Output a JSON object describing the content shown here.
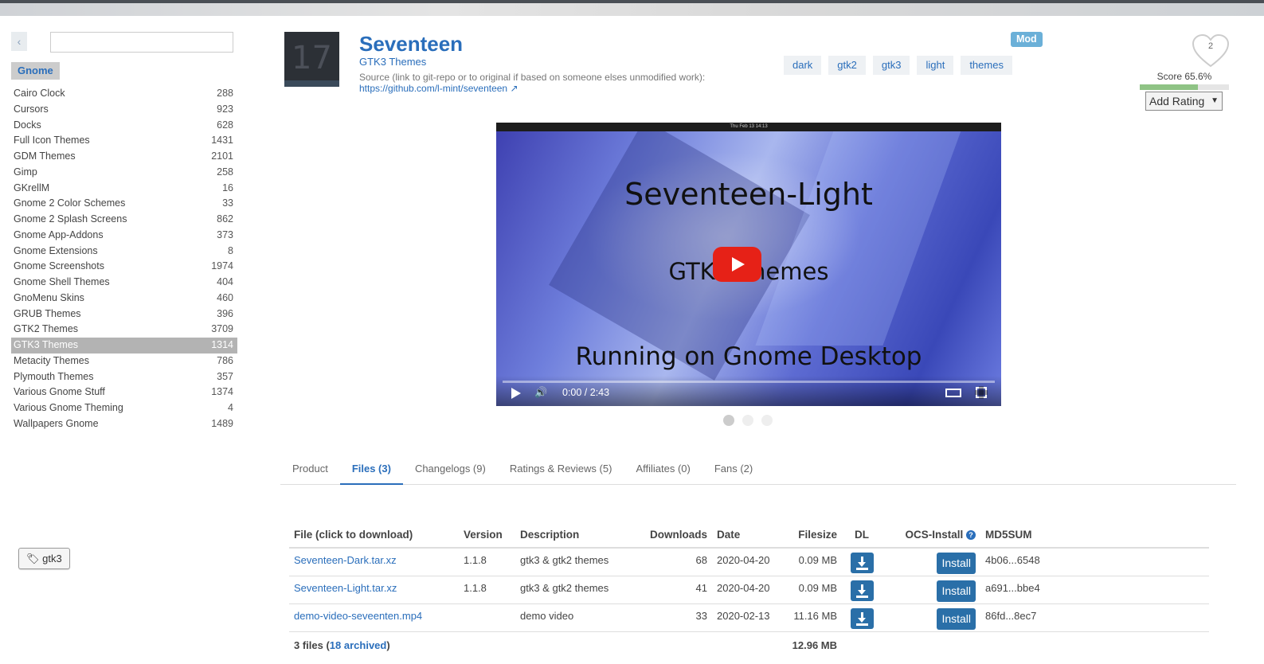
{
  "sidebar": {
    "header": "Gnome",
    "categories": [
      {
        "name": "Cairo Clock",
        "count": "288"
      },
      {
        "name": "Cursors",
        "count": "923"
      },
      {
        "name": "Docks",
        "count": "628"
      },
      {
        "name": "Full Icon Themes",
        "count": "1431"
      },
      {
        "name": "GDM Themes",
        "count": "2101"
      },
      {
        "name": "Gimp",
        "count": "258"
      },
      {
        "name": "GKrellM",
        "count": "16"
      },
      {
        "name": "Gnome 2 Color Schemes",
        "count": "33"
      },
      {
        "name": "Gnome 2 Splash Screens",
        "count": "862"
      },
      {
        "name": "Gnome App-Addons",
        "count": "373"
      },
      {
        "name": "Gnome Extensions",
        "count": "8"
      },
      {
        "name": "Gnome Screenshots",
        "count": "1974"
      },
      {
        "name": "Gnome Shell Themes",
        "count": "404"
      },
      {
        "name": "GnoMenu Skins",
        "count": "460"
      },
      {
        "name": "GRUB Themes",
        "count": "396"
      },
      {
        "name": "GTK2 Themes",
        "count": "3709"
      },
      {
        "name": "GTK3 Themes",
        "count": "1314"
      },
      {
        "name": "Metacity Themes",
        "count": "786"
      },
      {
        "name": "Plymouth Themes",
        "count": "357"
      },
      {
        "name": "Various Gnome Stuff",
        "count": "1374"
      },
      {
        "name": "Various Gnome Theming",
        "count": "4"
      },
      {
        "name": "Wallpapers Gnome",
        "count": "1489"
      }
    ],
    "active_index": 16,
    "tag_button": "gtk3"
  },
  "product": {
    "logo_text": "17",
    "title": "Seventeen",
    "category": "GTK3 Themes",
    "source_label": "Source (link to git-repo or to original if based on someone elses unmodified work):",
    "source_url": "https://github.com/l-mint/seventeen",
    "badge": "Mod",
    "tags": [
      "dark",
      "gtk2",
      "gtk3",
      "light",
      "themes"
    ],
    "fans_count": "2",
    "score_text": "Score 65.6%",
    "score_fraction": 0.656,
    "rating_select": "Add Rating"
  },
  "video": {
    "topbar_clock": "Thu Feb 13 14:13",
    "line1": "Seventeen-Light",
    "line2": "GTK3 Themes",
    "line3": "Running on Gnome Desktop",
    "time": "0:00 / 2:43"
  },
  "tabs": [
    {
      "label": "Product"
    },
    {
      "label": "Files (3)"
    },
    {
      "label": "Changelogs (9)"
    },
    {
      "label": "Ratings & Reviews (5)"
    },
    {
      "label": "Affiliates (0)"
    },
    {
      "label": "Fans (2)"
    }
  ],
  "active_tab": 1,
  "files_table": {
    "headers": {
      "file": "File (click to download)",
      "version": "Version",
      "description": "Description",
      "downloads": "Downloads",
      "date": "Date",
      "filesize": "Filesize",
      "dl": "DL",
      "ocs": "OCS-Install",
      "md5": "MD5SUM"
    },
    "rows": [
      {
        "file": "Seventeen-Dark.tar.xz",
        "version": "1.1.8",
        "description": "gtk3 & gtk2 themes",
        "downloads": "68",
        "date": "2020-04-20",
        "filesize": "0.09 MB",
        "install": "Install",
        "md5": "4b06...6548"
      },
      {
        "file": "Seventeen-Light.tar.xz",
        "version": "1.1.8",
        "description": "gtk3 & gtk2 themes",
        "downloads": "41",
        "date": "2020-04-20",
        "filesize": "0.09 MB",
        "install": "Install",
        "md5": "a691...bbe4"
      },
      {
        "file": "demo-video-seveenten.mp4",
        "version": "",
        "description": "demo video",
        "downloads": "33",
        "date": "2020-02-13",
        "filesize": "11.16 MB",
        "install": "Install",
        "md5": "86fd...8ec7"
      }
    ],
    "total": {
      "prefix": "3 files (",
      "archived": "18 archived",
      "suffix": ")",
      "size": "12.96 MB"
    }
  }
}
